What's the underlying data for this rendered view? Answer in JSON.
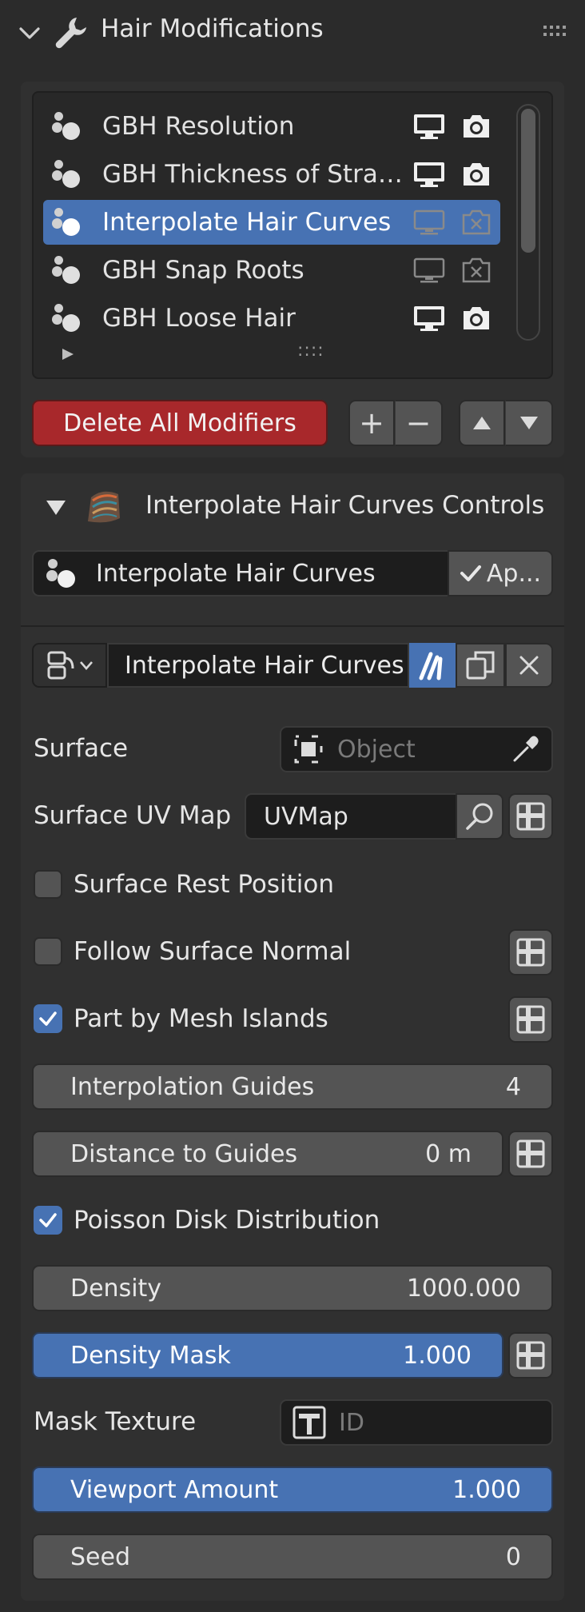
{
  "panel": {
    "title": "Hair Modifications"
  },
  "modifier_list": {
    "items": [
      {
        "label": "GBH Resolution",
        "enabled": true,
        "selected": false
      },
      {
        "label": "GBH Thickness of Stra…",
        "enabled": true,
        "selected": false
      },
      {
        "label": "Interpolate Hair Curves",
        "enabled": false,
        "selected": true
      },
      {
        "label": "GBH Snap Roots",
        "enabled": false,
        "selected": false
      },
      {
        "label": "GBH Loose Hair",
        "enabled": true,
        "selected": false
      }
    ],
    "grip": "::::"
  },
  "list_buttons": {
    "delete_all": "Delete All Modifiers",
    "add": "+",
    "remove": "−"
  },
  "controls": {
    "title": "Interpolate Hair Curves Controls",
    "node_name": "Interpolate Hair Curves",
    "apply_label": "Ap..."
  },
  "node_header": {
    "name": "Interpolate Hair Curves"
  },
  "properties": {
    "surface": {
      "label": "Surface",
      "placeholder": "Object"
    },
    "surface_uv": {
      "label": "Surface UV Map",
      "value": "UVMap"
    },
    "surface_rest": {
      "label": "Surface Rest Position",
      "checked": false
    },
    "follow_normal": {
      "label": "Follow Surface Normal",
      "checked": false
    },
    "part_islands": {
      "label": "Part by Mesh Islands",
      "checked": true
    },
    "interp_guides": {
      "label": "Interpolation Guides",
      "value": "4"
    },
    "distance_guides": {
      "label": "Distance to Guides",
      "value": "0 m"
    },
    "poisson": {
      "label": "Poisson Disk Distribution",
      "checked": true
    },
    "density": {
      "label": "Density",
      "value": "1000.000"
    },
    "density_mask": {
      "label": "Density Mask",
      "value": "1.000"
    },
    "mask_texture": {
      "label": "Mask Texture",
      "placeholder": "ID"
    },
    "viewport_amount": {
      "label": "Viewport Amount",
      "value": "1.000"
    },
    "seed": {
      "label": "Seed",
      "value": "0"
    }
  },
  "colors": {
    "accent_blue": "#4772b3",
    "delete_red": "#a8282b",
    "background": "#2b2b2b"
  }
}
